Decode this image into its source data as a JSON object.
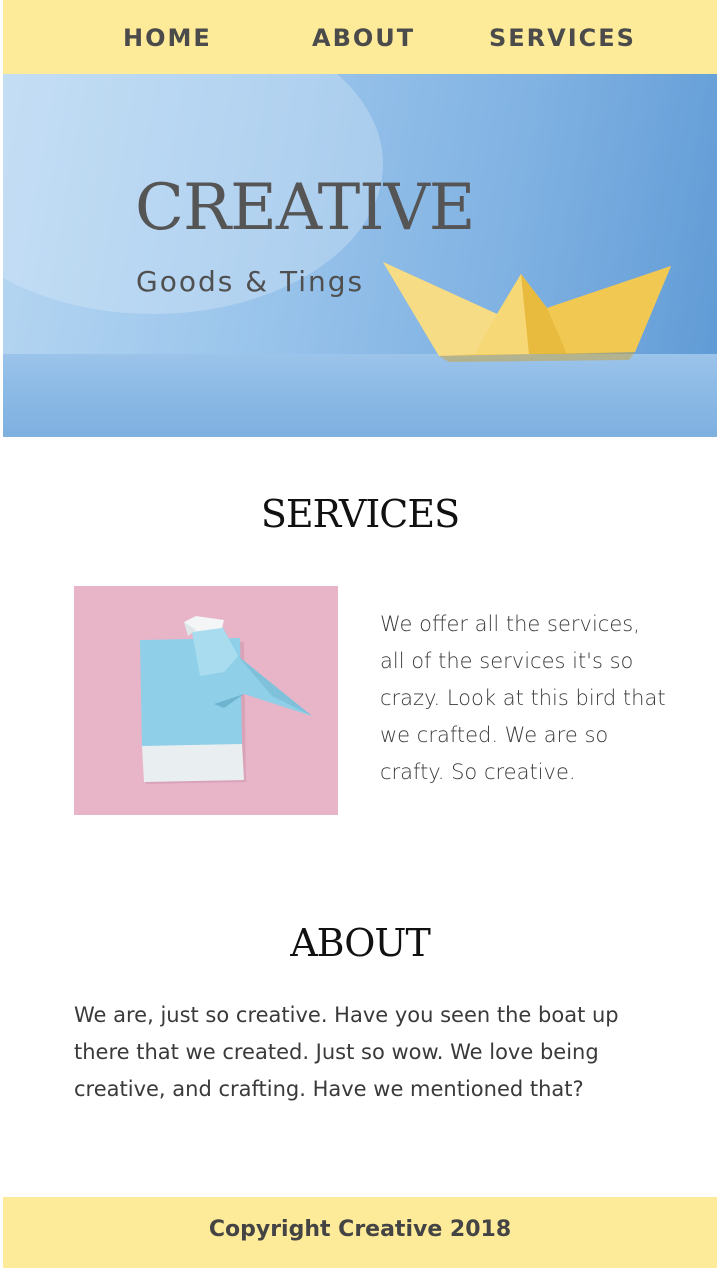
{
  "nav": {
    "items": [
      {
        "label": "HOME"
      },
      {
        "label": "ABOUT"
      },
      {
        "label": "SERVICES"
      }
    ]
  },
  "hero": {
    "title": "CREATIVE",
    "subtitle": "Goods & Tings"
  },
  "services": {
    "heading": "SERVICES",
    "text": "We offer all the services, all of the services it's so crazy. Look at this bird that we crafted. We are so crafty. So creative."
  },
  "about": {
    "heading": "ABOUT",
    "text": "We are, just so creative. Have you seen the boat up there that we created. Just so wow. We love being creative, and crafting. Have we mentioned that?"
  },
  "footer": {
    "text": "Copyright Creative 2018"
  },
  "colors": {
    "nav_background": "#feeb99",
    "footer_background": "#feeb99",
    "hero_sky": "#9cc6ec",
    "boat_yellow": "#f4d36b",
    "bird_card_pink": "#e8b5c8",
    "bird_blue": "#8fd0e8"
  },
  "images": {
    "hero": "paper-boat-image",
    "services": "origami-bird-image"
  }
}
